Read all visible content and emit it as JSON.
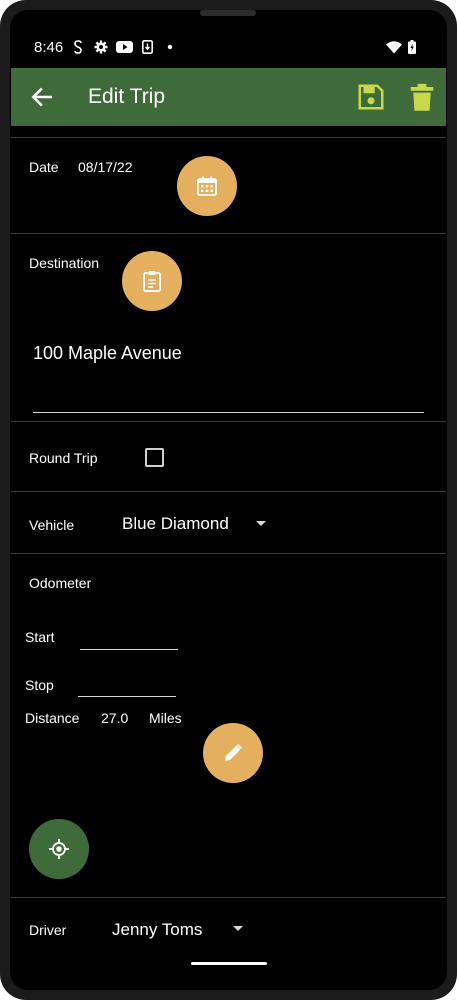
{
  "status_bar": {
    "time": "8:46"
  },
  "app_bar": {
    "title": "Edit Trip",
    "accent_color": "#3f6b3b",
    "icon_color": "#c8d84a"
  },
  "date": {
    "label": "Date",
    "value": "08/17/22"
  },
  "destination": {
    "label": "Destination",
    "value": "100 Maple Avenue"
  },
  "round_trip": {
    "label": "Round Trip",
    "checked": false
  },
  "vehicle": {
    "label": "Vehicle",
    "selected": "Blue Diamond"
  },
  "odometer": {
    "label": "Odometer",
    "start_label": "Start",
    "start_value": "",
    "stop_label": "Stop",
    "stop_value": "",
    "distance_label": "Distance",
    "distance_value": "27.0",
    "distance_unit": "Miles"
  },
  "driver": {
    "label": "Driver",
    "selected": "Jenny Toms"
  },
  "fab_color": "#e4b060"
}
